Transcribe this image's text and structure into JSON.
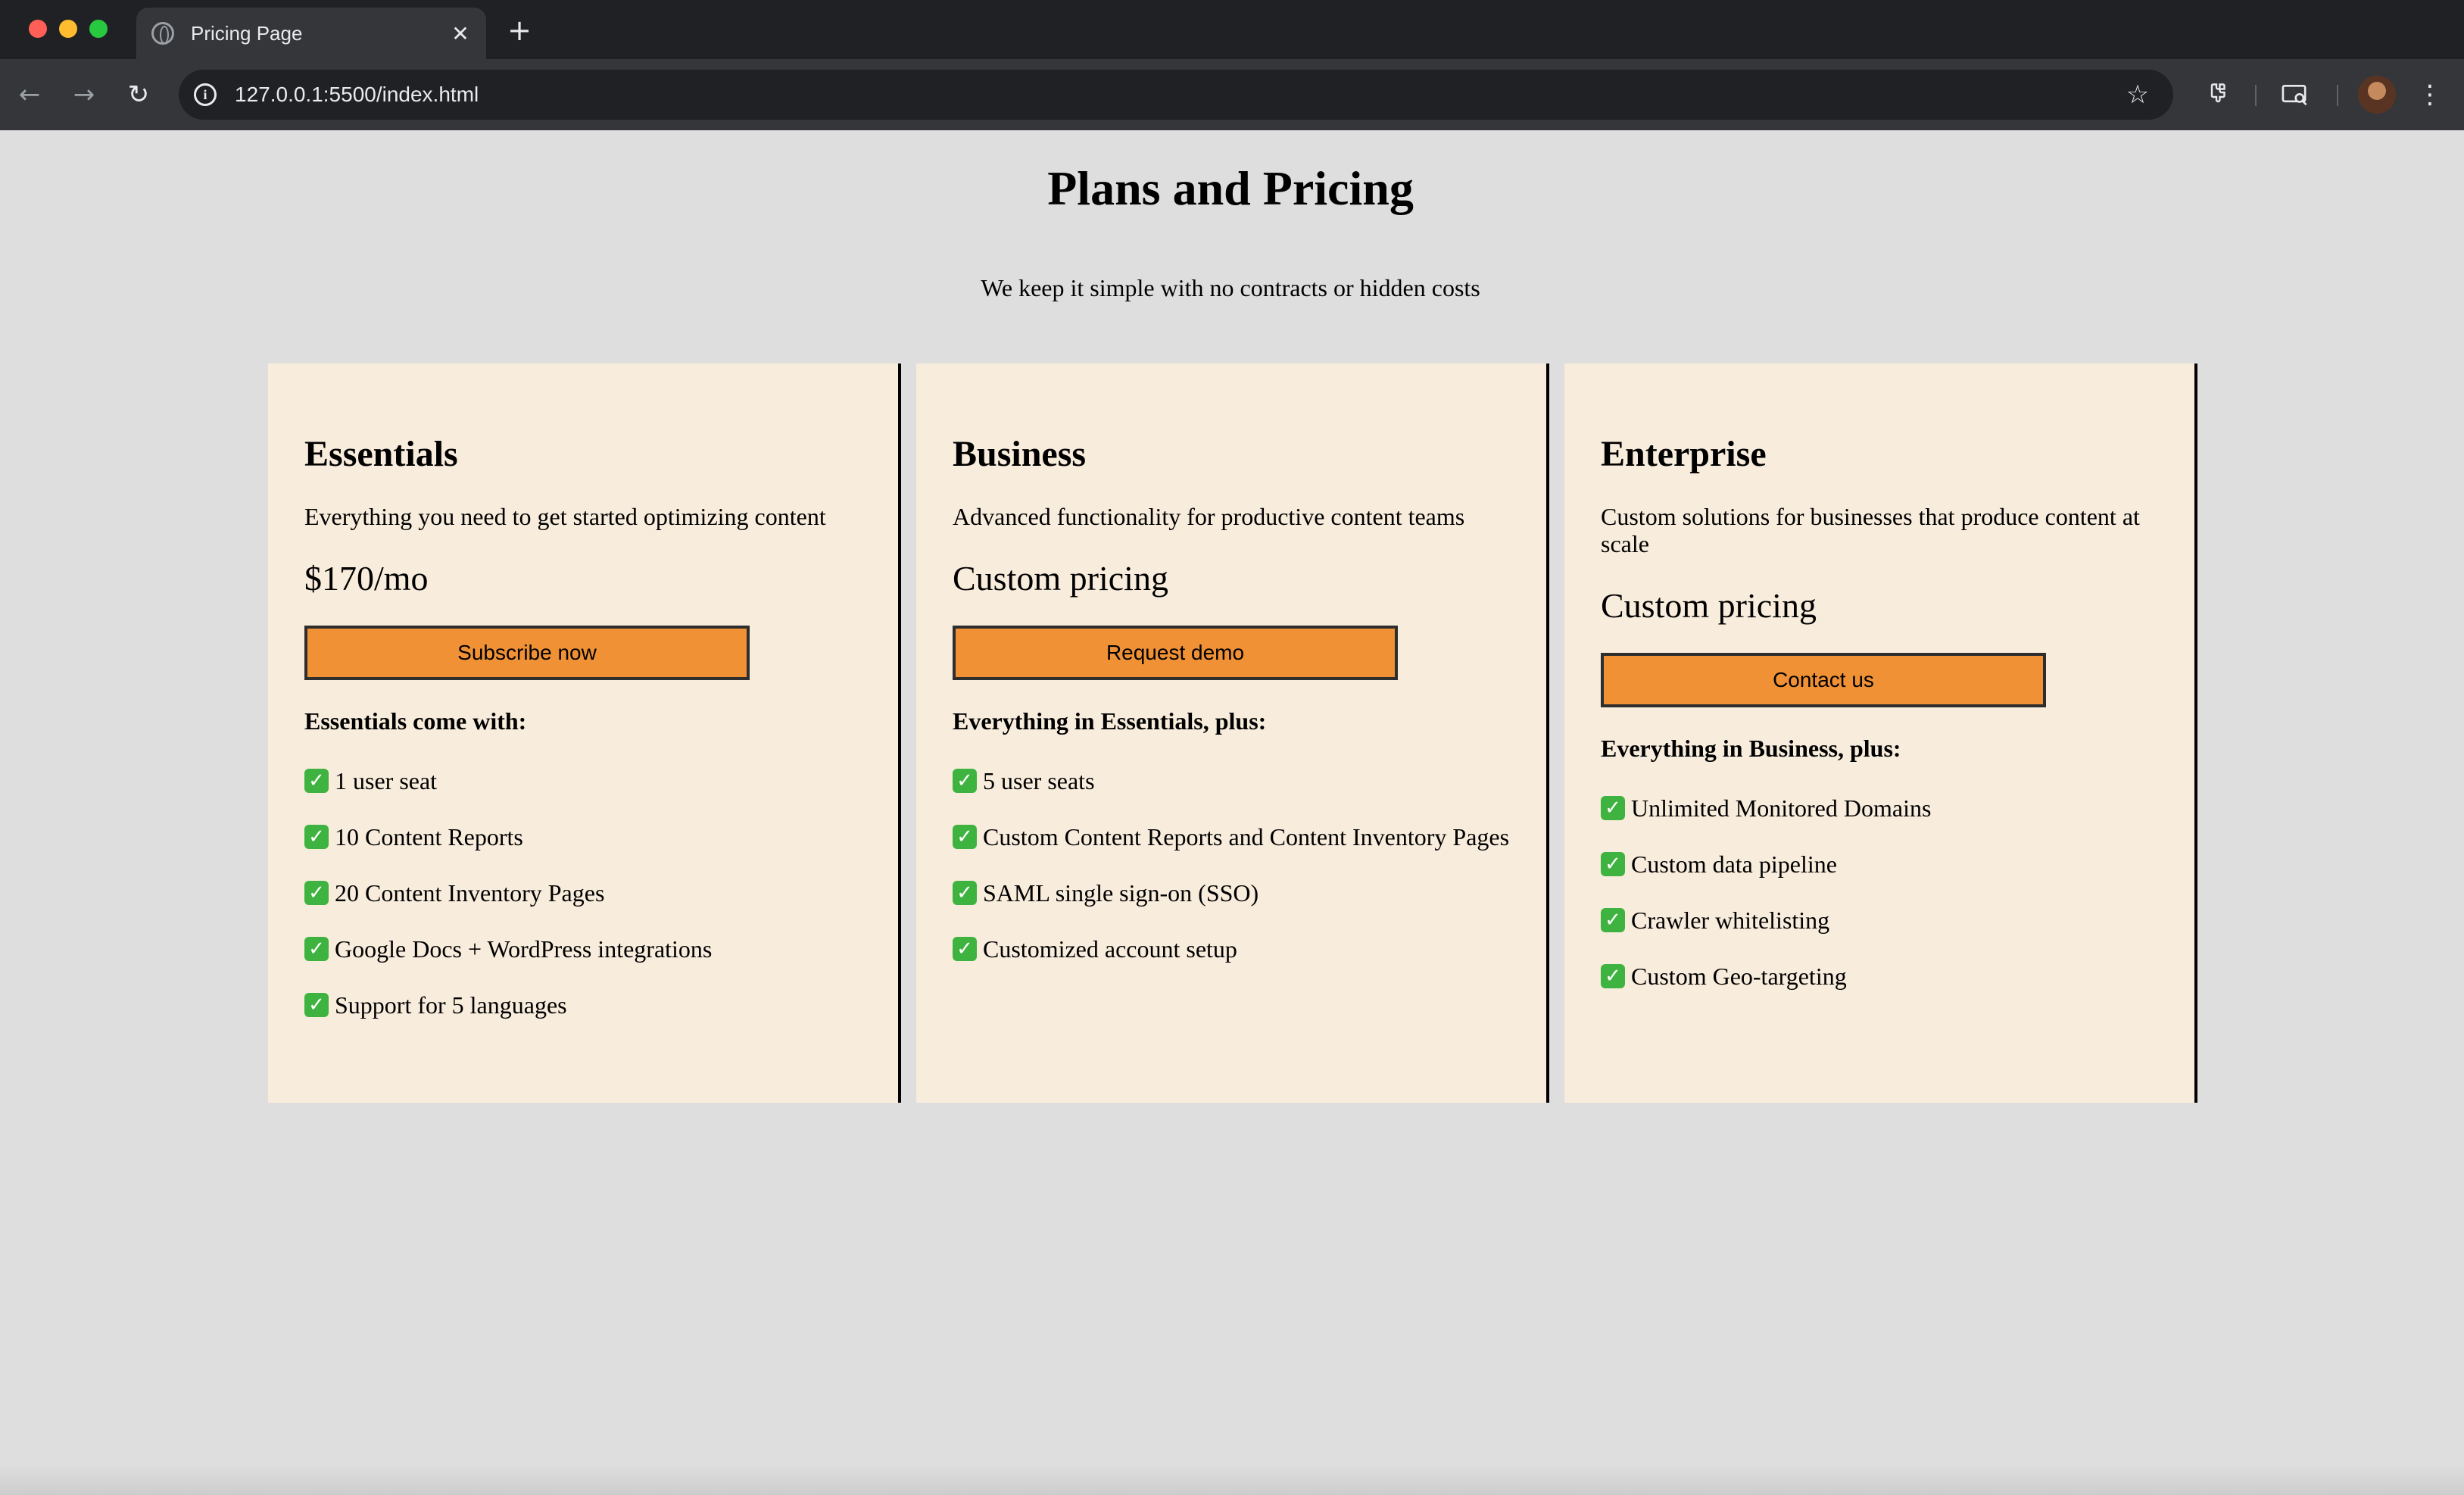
{
  "browser": {
    "tab_title": "Pricing Page",
    "tab_close_glyph": "✕",
    "new_tab_glyph": "+",
    "url": "127.0.0.1:5500/index.html",
    "icons": {
      "favicon": "globe-icon",
      "info": "info-icon",
      "star": "star-icon",
      "extensions": "puzzle-icon",
      "cast": "cast-icon",
      "menu": "more-vertical-icon"
    }
  },
  "page": {
    "title": "Plans and Pricing",
    "subtitle": "We keep it simple with no contracts or hidden costs"
  },
  "plans": [
    {
      "name": "Essentials",
      "description": "Everything you need to get started optimizing content",
      "price": "$170/mo",
      "button_label": "Subscribe now",
      "features_heading": "Essentials come with:",
      "features": [
        "1 user seat",
        "10 Content Reports",
        "20 Content Inventory Pages",
        "Google Docs + WordPress integrations",
        "Support for 5 languages"
      ]
    },
    {
      "name": "Business",
      "description": "Advanced functionality for productive content teams",
      "price": "Custom pricing",
      "button_label": "Request demo",
      "features_heading": "Everything in Essentials, plus:",
      "features": [
        "5 user seats",
        "Custom Content Reports and Content Inventory Pages",
        "SAML single sign-on (SSO)",
        "Customized account setup"
      ]
    },
    {
      "name": "Enterprise",
      "description": "Custom solutions for businesses that produce content at scale",
      "price": "Custom pricing",
      "button_label": "Contact us",
      "features_heading": "Everything in Business, plus:",
      "features": [
        "Unlimited Monitored Domains",
        "Custom data pipeline",
        "Crawler whitelisting",
        "Custom Geo-targeting"
      ]
    }
  ],
  "colors": {
    "page_background": "#dedede",
    "card_background": "#f8ecdc",
    "button_background": "#f19135",
    "check_green": "#3fb33f"
  }
}
